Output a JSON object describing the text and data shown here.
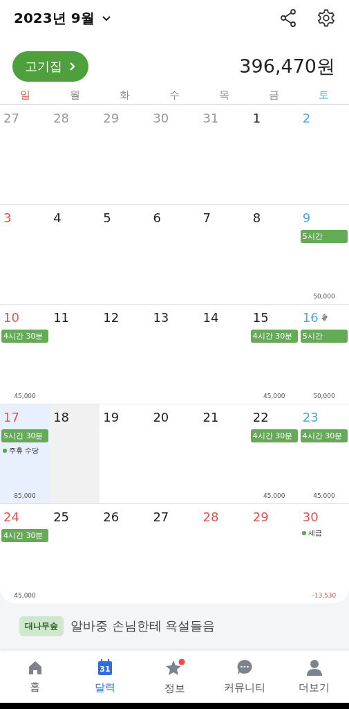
{
  "header": {
    "title": "2023년 9월"
  },
  "workplace": {
    "label": "고기집",
    "total": "396,470원"
  },
  "weekdays": [
    {
      "label": "일",
      "kind": "sunday"
    },
    {
      "label": "월",
      "kind": "weekday"
    },
    {
      "label": "화",
      "kind": "weekday"
    },
    {
      "label": "수",
      "kind": "weekday"
    },
    {
      "label": "목",
      "kind": "weekday"
    },
    {
      "label": "금",
      "kind": "weekday"
    },
    {
      "label": "토",
      "kind": "saturday"
    }
  ],
  "weeks": [
    [
      {
        "date": "27",
        "kind": "other"
      },
      {
        "date": "28",
        "kind": "other"
      },
      {
        "date": "29",
        "kind": "other"
      },
      {
        "date": "30",
        "kind": "other"
      },
      {
        "date": "31",
        "kind": "other"
      },
      {
        "date": "1",
        "kind": "weekday"
      },
      {
        "date": "2",
        "kind": "saturday"
      }
    ],
    [
      {
        "date": "3",
        "kind": "sunday"
      },
      {
        "date": "4",
        "kind": "weekday"
      },
      {
        "date": "5",
        "kind": "weekday"
      },
      {
        "date": "6",
        "kind": "weekday"
      },
      {
        "date": "7",
        "kind": "weekday"
      },
      {
        "date": "8",
        "kind": "weekday"
      },
      {
        "date": "9",
        "kind": "saturday",
        "shifts": [
          "5시간"
        ],
        "amount": "50,000"
      }
    ],
    [
      {
        "date": "10",
        "kind": "sunday",
        "shifts": [
          "4시간 30분"
        ],
        "amount": "45,000"
      },
      {
        "date": "11",
        "kind": "weekday"
      },
      {
        "date": "12",
        "kind": "weekday"
      },
      {
        "date": "13",
        "kind": "weekday"
      },
      {
        "date": "14",
        "kind": "weekday"
      },
      {
        "date": "15",
        "kind": "weekday",
        "shifts": [
          "4시간 30분"
        ],
        "amount": "45,000"
      },
      {
        "date": "16",
        "kind": "saturday",
        "memo": true,
        "shifts": [
          "5시간"
        ],
        "amount": "50,000"
      }
    ],
    [
      {
        "date": "17",
        "kind": "sunday",
        "selected": true,
        "shifts": [
          "5시간 30분"
        ],
        "notes": [
          {
            "text": "주휴 수당",
            "color": "#5aa54a"
          }
        ],
        "amount": "85,000"
      },
      {
        "date": "18",
        "kind": "weekday",
        "today": true
      },
      {
        "date": "19",
        "kind": "weekday"
      },
      {
        "date": "20",
        "kind": "weekday"
      },
      {
        "date": "21",
        "kind": "weekday"
      },
      {
        "date": "22",
        "kind": "weekday",
        "shifts": [
          "4시간 30분"
        ],
        "amount": "45,000"
      },
      {
        "date": "23",
        "kind": "saturday",
        "shifts": [
          "4시간 30분"
        ],
        "amount": "45,000"
      }
    ],
    [
      {
        "date": "24",
        "kind": "sunday",
        "shifts": [
          "4시간 30분"
        ],
        "amount": "45,000"
      },
      {
        "date": "25",
        "kind": "weekday"
      },
      {
        "date": "26",
        "kind": "weekday"
      },
      {
        "date": "27",
        "kind": "weekday"
      },
      {
        "date": "28",
        "kind": "holiday"
      },
      {
        "date": "29",
        "kind": "holiday"
      },
      {
        "date": "30",
        "kind": "holiday",
        "notes": [
          {
            "text": "세금",
            "color": "#5aa54a"
          }
        ],
        "amount": "-13,530",
        "negative": true
      }
    ]
  ],
  "banner": {
    "tag": "대나무숲",
    "text": "알바중 손님한테 욕설들음"
  },
  "nav": [
    {
      "label": "홈",
      "selected": false
    },
    {
      "label": "달력",
      "badge": "31",
      "selected": true
    },
    {
      "label": "정보",
      "dot": true,
      "selected": false
    },
    {
      "label": "커뮤니티",
      "selected": false
    },
    {
      "label": "더보기",
      "selected": false
    }
  ]
}
